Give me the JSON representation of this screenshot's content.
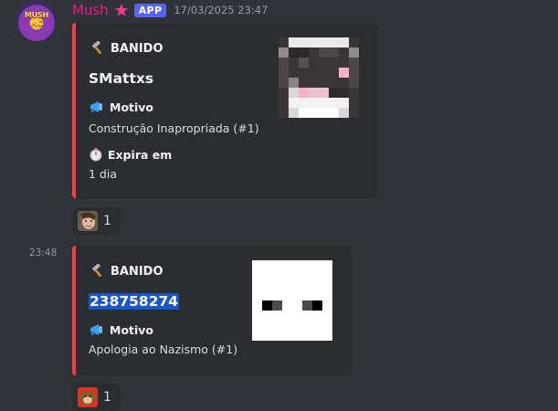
{
  "message": {
    "author": "Mush",
    "badge": "APP",
    "timestamp": "17/03/2025 23:47",
    "avatar_text": "MUSH MC"
  },
  "embeds": [
    {
      "author_label": "BANIDO",
      "author_icon": "hammer-icon",
      "title": "SMattxs",
      "fields": [
        {
          "name": "Motivo",
          "icon": "megaphone-icon",
          "value": "Construção Inapropriada (#1)"
        },
        {
          "name": "Expira em",
          "icon": "stopwatch-icon",
          "value": "1 dia"
        }
      ],
      "accent_color": "#ed4245"
    },
    {
      "side_time": "23:48",
      "author_label": "BANIDO",
      "author_icon": "hammer-icon",
      "title": "238758274",
      "fields": [
        {
          "name": "Motivo",
          "icon": "megaphone-icon",
          "value": "Apologia ao Nazismo (#1)"
        }
      ],
      "accent_color": "#ed4245"
    }
  ],
  "reactions": [
    {
      "emoji": "face-emoji",
      "count": "1"
    },
    {
      "emoji": "monkey-emoji",
      "count": "1"
    }
  ]
}
